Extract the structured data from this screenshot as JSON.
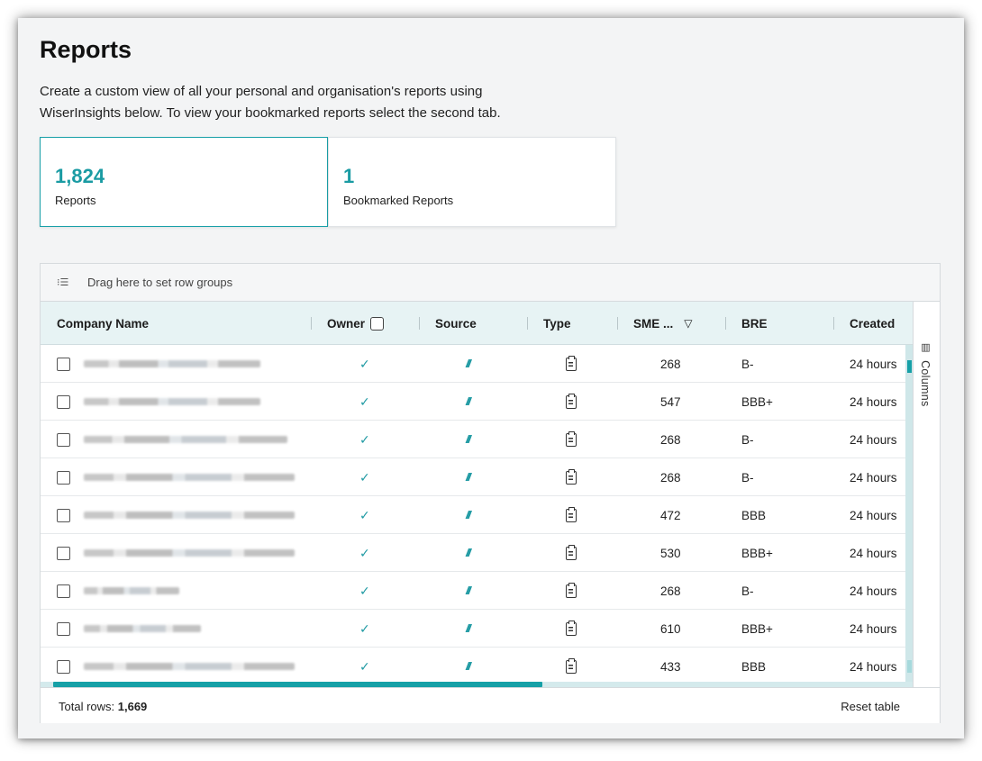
{
  "page": {
    "title": "Reports",
    "intro_line1": "Create a custom view of all your personal and organisation's reports using",
    "intro_line2": "WiserInsights below. To view your bookmarked reports select the second tab."
  },
  "cards": [
    {
      "count": "1,824",
      "label": "Reports"
    },
    {
      "count": "1",
      "label": "Bookmarked Reports"
    }
  ],
  "grid": {
    "group_bar_text": "Drag here to set row groups",
    "columns": {
      "company": "Company Name",
      "owner": "Owner",
      "source": "Source",
      "type": "Type",
      "sme": "SME ...",
      "bre": "BRE",
      "created": "Created"
    },
    "side_panel_label": "Columns",
    "rows": [
      {
        "sme": "268",
        "bre": "B-",
        "created": "24 hours"
      },
      {
        "sme": "547",
        "bre": "BBB+",
        "created": "24 hours"
      },
      {
        "sme": "268",
        "bre": "B-",
        "created": "24 hours"
      },
      {
        "sme": "268",
        "bre": "B-",
        "created": "24 hours"
      },
      {
        "sme": "472",
        "bre": "BBB",
        "created": "24 hours"
      },
      {
        "sme": "530",
        "bre": "BBB+",
        "created": "24 hours"
      },
      {
        "sme": "268",
        "bre": "B-",
        "created": "24 hours"
      },
      {
        "sme": "610",
        "bre": "BBB+",
        "created": "24 hours"
      },
      {
        "sme": "433",
        "bre": "BBB",
        "created": "24 hours"
      }
    ],
    "footer": {
      "total_label": "Total rows: ",
      "total_value": "1,669",
      "reset_label": "Reset table"
    }
  },
  "colors": {
    "accent": "#1a9ba3",
    "header_bg": "#e7f3f4"
  },
  "icons": {
    "owner_cell": "check-icon",
    "source_cell": "source-icon",
    "type_cell": "clipboard-icon",
    "group_bar": "row-group-icon",
    "sme_filter": "filter-icon",
    "side_panel": "columns-icon"
  }
}
